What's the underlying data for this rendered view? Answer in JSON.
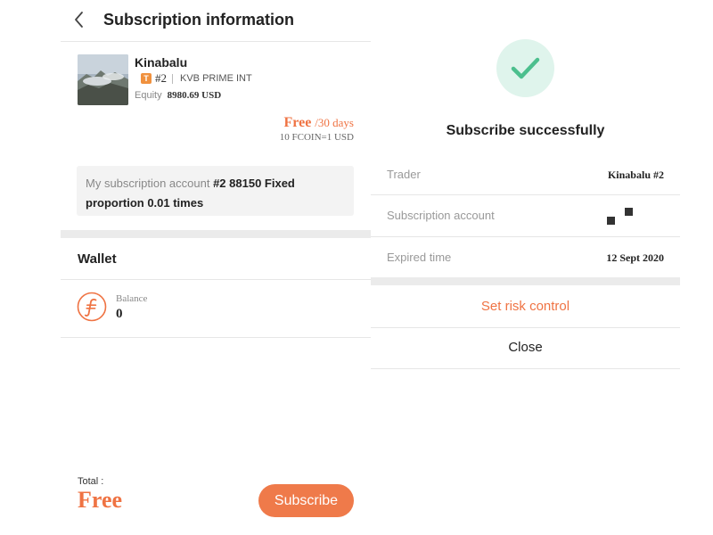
{
  "header": {
    "title": "Subscription information"
  },
  "trader": {
    "name": "Kinabalu",
    "badge": "T",
    "rank": "#2",
    "broker": "KVB PRIME INT",
    "equity_label": "Equity",
    "equity_value": "8980.69 USD"
  },
  "pricing": {
    "price": "Free",
    "period": "/30 days",
    "rate": "10 FCOIN=1 USD"
  },
  "subscription_account": {
    "label": "My subscription account",
    "value": "#2 88150 Fixed proportion 0.01 times"
  },
  "wallet": {
    "title": "Wallet",
    "balance_label": "Balance",
    "balance_value": "0",
    "icon": "fcoin-icon"
  },
  "footer": {
    "total_label": "Total :",
    "total_value": "Free",
    "subscribe_label": "Subscribe"
  },
  "success": {
    "title": "Subscribe successfully",
    "icon": "check-icon",
    "rows": [
      {
        "label": "Trader",
        "value": "Kinabalu #2"
      },
      {
        "label": "Subscription account",
        "value": ""
      },
      {
        "label": "Expired time",
        "value": "12 Sept 2020"
      }
    ],
    "risk_label": "Set risk control",
    "close_label": "Close"
  },
  "colors": {
    "accent": "#ef7343",
    "button": "#ef7a4a",
    "check": "#4cbf8e",
    "check_bg": "#dff4ec",
    "divider_band": "#ebebeb",
    "badge": "#f0913e"
  }
}
